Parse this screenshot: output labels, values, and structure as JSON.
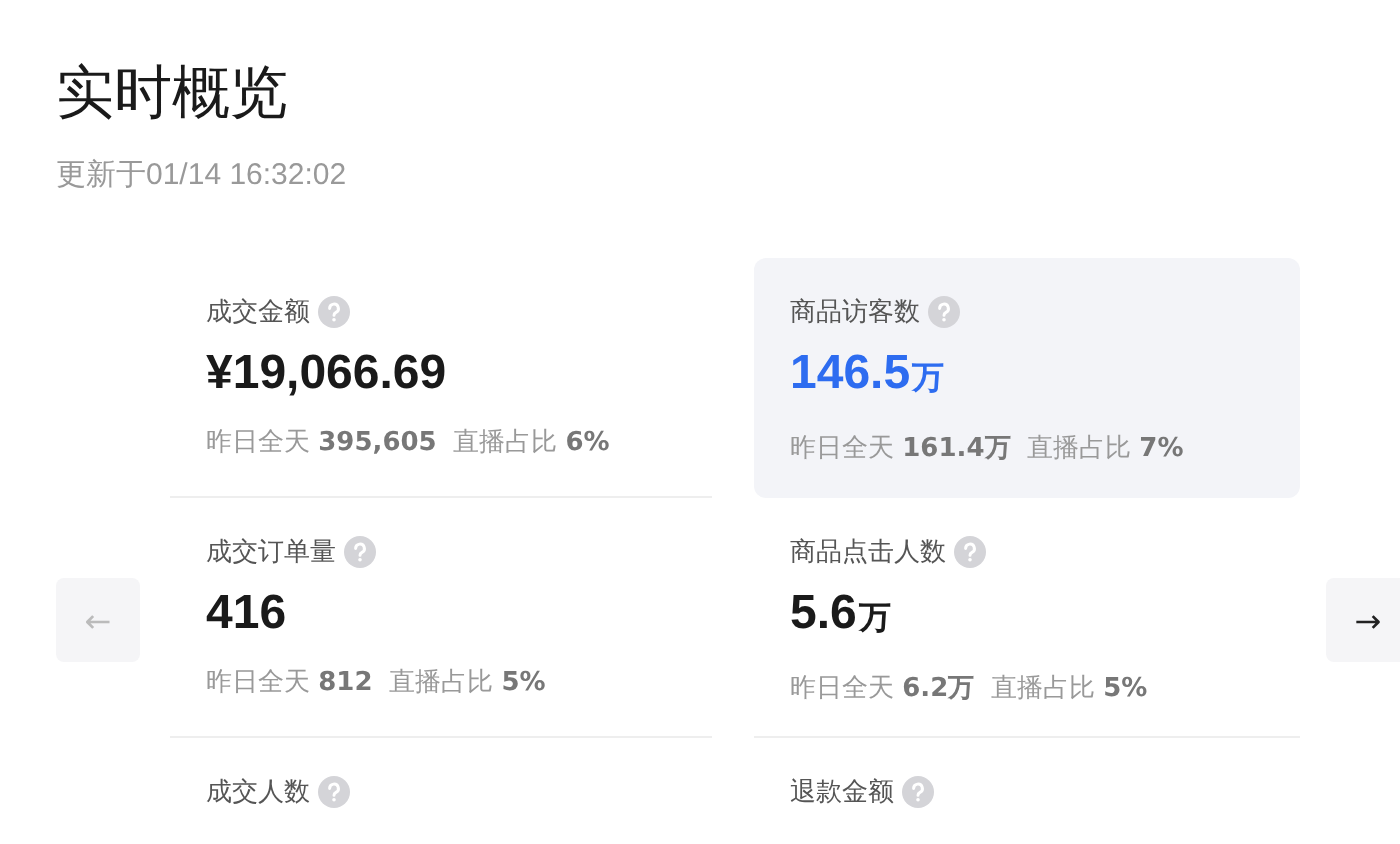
{
  "title": "实时概览",
  "updated": "更新于01/14 16:32:02",
  "prev_button": {
    "label": "←",
    "disabled": true
  },
  "next_button": {
    "label": "→",
    "disabled": false
  },
  "metrics": [
    {
      "label": "成交金额",
      "value": "¥19,066.69",
      "selected": false,
      "sub": "昨日全天 **395,605**  直播占比 **6%**"
    },
    {
      "label": "商品访客数",
      "value": "146.5",
      "unit": "万",
      "selected": true,
      "sub": "昨日全天 **161.4万**  直播占比 **7%**"
    },
    {
      "label": "成交订单量",
      "value": "416",
      "selected": false,
      "sub": "昨日全天 **812**  直播占比 **5%**"
    },
    {
      "label": "商品点击人数",
      "value": "5.6",
      "unit": "万",
      "selected": false,
      "sub": "昨日全天 **6.2万**  直播占比 **5%**"
    },
    {
      "label": "成交人数",
      "selected": false
    },
    {
      "label": "退款金额",
      "selected": false
    }
  ]
}
